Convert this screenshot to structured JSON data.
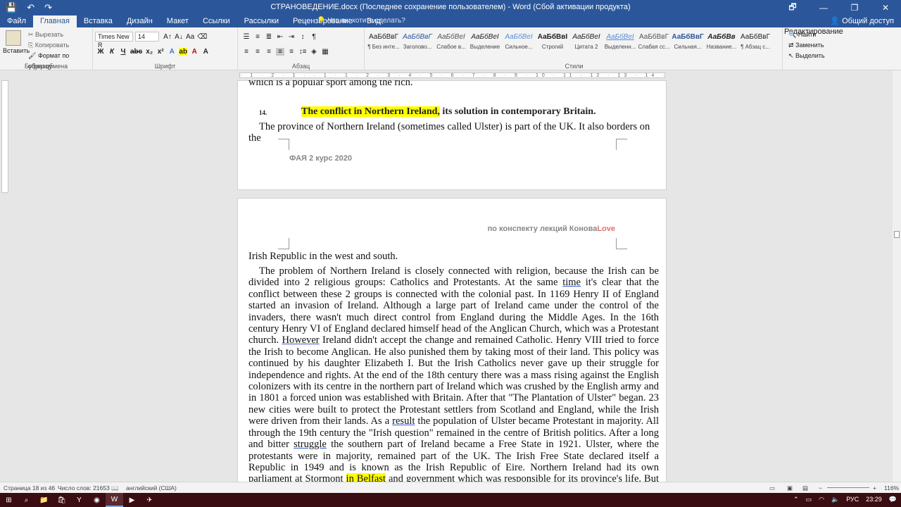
{
  "titlebar": {
    "title": "СТРАНОВЕДЕНИЕ.docx (Последнее сохранение пользователем) - Word (Сбой активации продукта)",
    "save_icon": "💾",
    "undo_icon": "↶",
    "redo_icon": "↷",
    "restore_icon": "🗗",
    "minimize_icon": "—",
    "maximize_icon": "❐",
    "close_icon": "✕"
  },
  "tabs": [
    "Файл",
    "Главная",
    "Вставка",
    "Дизайн",
    "Макет",
    "Ссылки",
    "Рассылки",
    "Рецензирование",
    "Вид"
  ],
  "tell_me": "Что вы хотите сделать?",
  "share": "Общий доступ",
  "ribbon": {
    "clipboard": {
      "paste": "Вставить",
      "cut": "Вырезать",
      "copy": "Копировать",
      "format_painter": "Формат по образцу",
      "label": "Буфер обмена"
    },
    "font": {
      "name": "Times New R",
      "size": "14",
      "label": "Шрифт"
    },
    "paragraph": {
      "label": "Абзац"
    },
    "styles": {
      "label": "Стили",
      "items": [
        {
          "sample": "АаБбВвГ",
          "name": "¶ Без инте..."
        },
        {
          "sample": "АаБбВвГ",
          "name": "Заголово..."
        },
        {
          "sample": "АаБбВеІ",
          "name": "Слабое в..."
        },
        {
          "sample": "АаБбВеІ",
          "name": "Выделение"
        },
        {
          "sample": "АаБбВеІ",
          "name": "Сильное..."
        },
        {
          "sample": "АаБбВвІ",
          "name": "Строгий"
        },
        {
          "sample": "АаБбВеІ",
          "name": "Цитата 2"
        },
        {
          "sample": "АаБбВеІ",
          "name": "Выделенн..."
        },
        {
          "sample": "АаБбВвГ",
          "name": "Слабая сс..."
        },
        {
          "sample": "АаБбВвГ",
          "name": "Сильная..."
        },
        {
          "sample": "АаБбВв",
          "name": "Название..."
        },
        {
          "sample": "АаБбВвГ",
          "name": "¶ Абзац с..."
        }
      ]
    },
    "editing": {
      "find": "Найти",
      "replace": "Заменить",
      "select": "Выделить",
      "label": "Редактирование"
    }
  },
  "ruler": {
    "marks": "· 1 · 2 · 1 · · 1 · 1 · 2 · 3 · 4 · 5 · 6 · 7 · 8 · 9 · 10 · 11 · 12 · 13 · 14 · 15 · 16 · 17 · 18"
  },
  "document": {
    "page1_top_line": "which is a popular sport among the rich.",
    "heading_num": "14.",
    "heading_highlight": "The conflict in Northern Ireland,",
    "heading_rest": " its solution in contemporary Britain.",
    "page1_para": "The province of Northern Ireland (sometimes called Ulster) is part of the UK. It also borders on the",
    "page1_footer": "ФАЯ 2 курс 2020",
    "page2_header": "по конспекту лекций Конова",
    "page2_header_love": "Love",
    "page2_first": "Irish Republic in the west and south.",
    "p2_a": "The problem of Northern Ireland is closely connected with religion, because the Irish can be divided into 2 religious groups: Catholics and Protestants. At the same ",
    "p2_time": "time",
    "p2_b": " it's clear that the conflict between these 2 groups is connected with the colonial past. In 1169 Henry II of England started an invasion of Ireland. Although a large part of Ireland came under the control of the invaders, there wasn't much direct control from England during the Middle Ages. In the 16th century Henry VI of England declared himself head of the Anglican Church, which was a Protestant church. ",
    "p2_however": "However",
    "p2_c": " Ireland didn't accept the change and remained Catholic. Henry VIII tried to force the Irish to become Anglican. He also punished them by taking most of their land. This policy was continued by his daughter Elizabeth I. But the Irish Catholics never gave up their struggle for independence and rights. At the end of the 18th century there was a mass rising against the English colonizers with its centre in the northern part of Ireland which was crushed by the English army and in 1801 a forced union was established with Britain. After that \"The Plantation of Ulster\" began. 23 new cities were built to protect the Protestant settlers from Scotland and England, while the Irish were driven from their lands. As a ",
    "p2_result": "result",
    "p2_d": " the population of Ulster became Protestant in majority. All through the 19th century the \"Irish question\" remained in the centre of British politics. After a long and bitter ",
    "p2_struggle": "struggle",
    "p2_e": " the southern part of Ireland became a Free State in 1921. Ulster, where the protestants were in majority, remained part of the UK. The Irish Free State declared itself a Republic in 1949 and is known as the Irish Republic of Eire. Northern Ireland had its own parliament at Stormont ",
    "p2_belfast": "in Belfast",
    "p2_f": " and government which was responsible for its province's life. But from the beginning the parliament was in the hands of the Protestants while"
  },
  "status": {
    "page": "Страница 18 из 46",
    "words": "Число слов: 21653",
    "lang": "английский (США)",
    "zoom": "116%"
  },
  "taskbar": {
    "lang": "РУС",
    "time": "23:29"
  }
}
